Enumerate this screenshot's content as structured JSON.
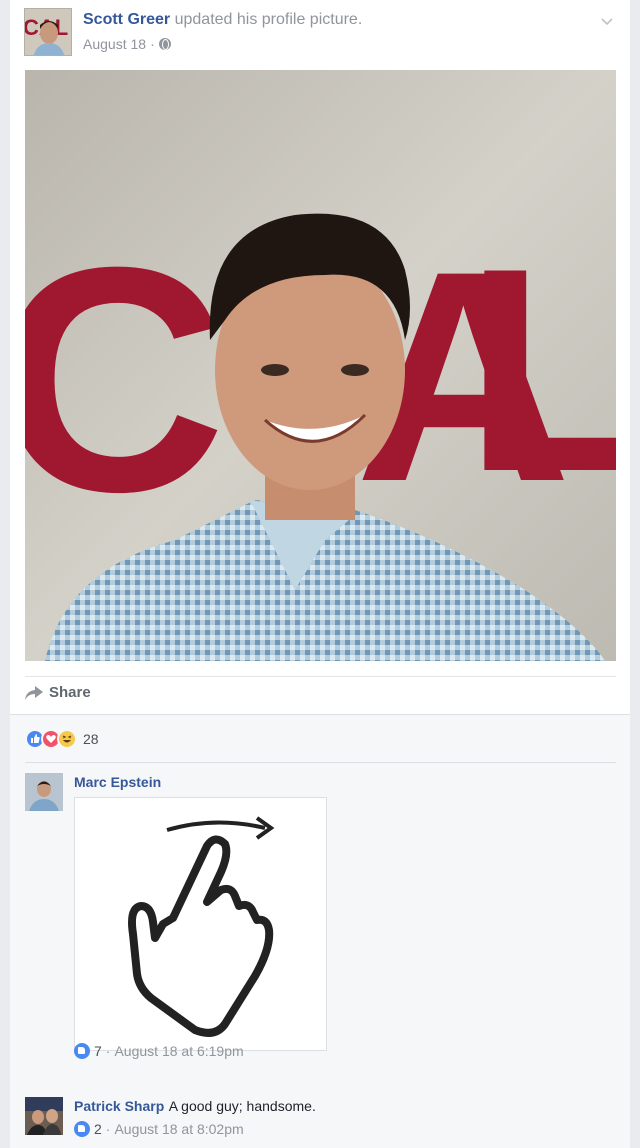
{
  "post": {
    "author": "Scott Greer",
    "action": "updated his profile picture.",
    "date": "August 18",
    "separator": "·",
    "privacy_icon": "globe-icon",
    "menu_icon": "chevron-down-icon",
    "avatar_text": "CAL"
  },
  "photo": {
    "wall_letters": [
      "C",
      "A",
      "L"
    ]
  },
  "actions": {
    "share_label": "Share",
    "share_icon": "share-arrow-icon"
  },
  "reactions": {
    "icons": [
      "like-icon",
      "love-icon",
      "haha-icon"
    ],
    "count": "28"
  },
  "comments": [
    {
      "author": "Marc Epstein",
      "text": "",
      "sticker": "swipe-hand-sticker",
      "likes": "7",
      "separator": "·",
      "timestamp": "August 18 at 6:19pm"
    },
    {
      "author": "Patrick Sharp",
      "text": "A good guy; handsome.",
      "likes": "2",
      "separator": "·",
      "timestamp": "August 18 at 8:02pm"
    }
  ],
  "colors": {
    "link": "#365899",
    "meta": "#90949c",
    "like_blue": "#4a89f3",
    "love_red": "#f25268",
    "haha_yellow": "#f7c94b",
    "wall_red": "#a01830"
  }
}
